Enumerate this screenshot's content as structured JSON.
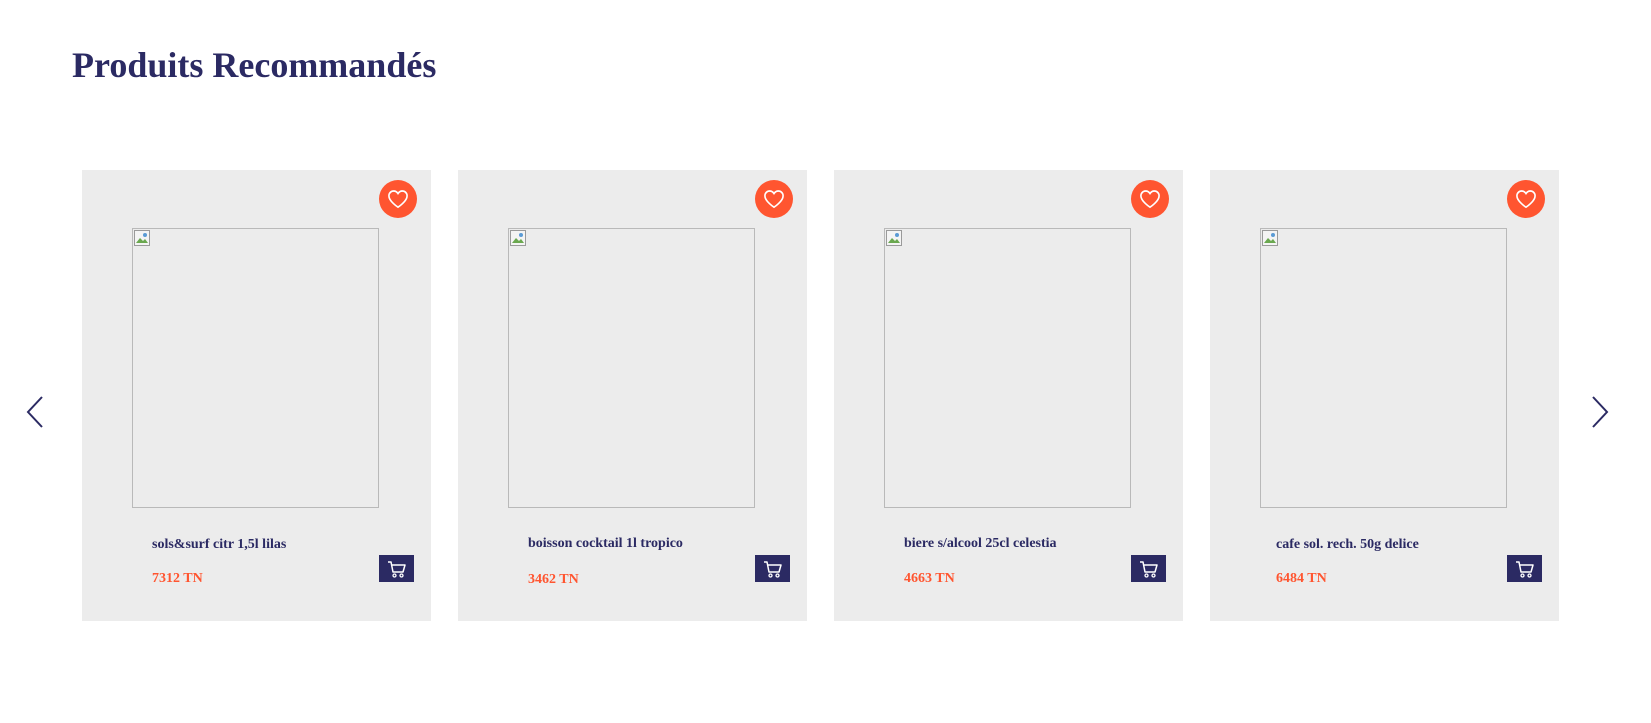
{
  "section": {
    "title": "Produits Recommandés"
  },
  "carousel": {
    "prev_icon": "chevron-left-icon",
    "next_icon": "chevron-right-icon"
  },
  "products": [
    {
      "name": "sols&surf citr 1,5l lilas",
      "price": "7312 TN"
    },
    {
      "name": "boisson cocktail 1l tropico",
      "price": "3462 TN"
    },
    {
      "name": "biere s/alcool 25cl celestia",
      "price": "4663 TN"
    },
    {
      "name": "cafe sol. rech. 50g delice",
      "price": "6484 TN"
    }
  ],
  "icons": {
    "favorite": "heart-icon",
    "cart": "cart-icon",
    "image_placeholder": "broken-image-icon"
  },
  "colors": {
    "primary": "#2b2a63",
    "accent": "#ff5530",
    "card_background": "#ececec"
  }
}
